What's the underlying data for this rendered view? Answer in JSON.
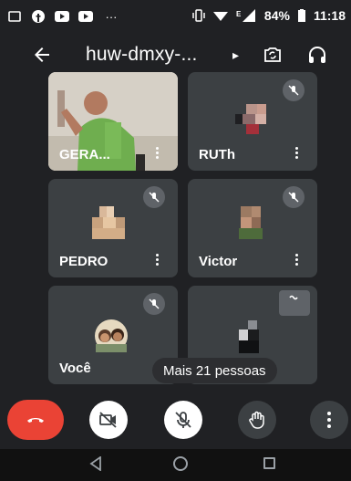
{
  "status_bar": {
    "battery": "84%",
    "time": "11:18"
  },
  "meeting": {
    "code": "huw-dmxy-..."
  },
  "participants": [
    {
      "name": "GERA...",
      "muted": false
    },
    {
      "name": "RUTh",
      "muted": true
    },
    {
      "name": "PEDRO",
      "muted": true
    },
    {
      "name": "Victor",
      "muted": true
    },
    {
      "name": "Você",
      "muted": true
    },
    {
      "name": "",
      "muted": false
    }
  ],
  "more_people": "Mais 21 pessoas",
  "icons": {
    "back": "arrow-left-icon",
    "switch_camera": "switch-camera-icon",
    "audio": "headset-icon",
    "end_call": "phone-hangup-icon",
    "camera": "camera-off-icon",
    "mic": "mic-off-icon",
    "hand": "raise-hand-icon",
    "more": "more-vert-icon"
  },
  "colors": {
    "background": "#202124",
    "tile": "#3c4043",
    "end_call": "#ea4335"
  }
}
